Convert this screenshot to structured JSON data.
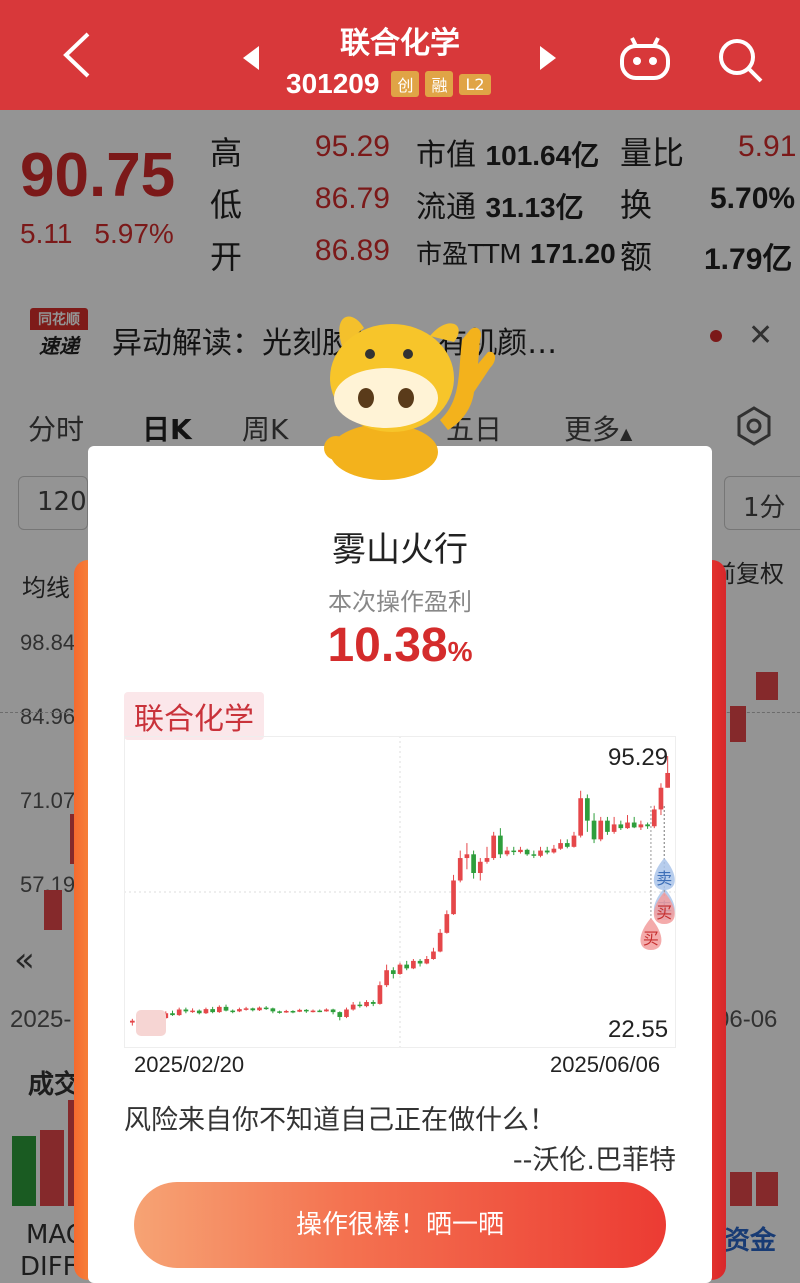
{
  "header": {
    "stock_name": "联合化学",
    "stock_code": "301209",
    "badges": [
      {
        "label": "创",
        "color": "#e2a13a"
      },
      {
        "label": "融",
        "color": "#e2a13a"
      },
      {
        "label": "L2",
        "color": "#e2a13a"
      }
    ]
  },
  "quote": {
    "price": "90.75",
    "change": "5.11",
    "change_pct": "5.97%",
    "high_label": "高",
    "high": "95.29",
    "low_label": "低",
    "low": "86.79",
    "open_label": "开",
    "open": "86.89",
    "mcap_label": "市值",
    "mcap": "101.64亿",
    "float_label": "流通",
    "float": "31.13亿",
    "pe_label": "市盈TTM",
    "pe": "171.20",
    "vr_label": "量比",
    "vr": "5.91",
    "turnover_label": "换",
    "turnover": "5.70%",
    "amount_label": "额",
    "amount": "1.79亿"
  },
  "news": {
    "logo_top": "同花顺",
    "logo_bottom": "速递",
    "text": "异动解读：光刻胶材料+有机颜…"
  },
  "tabs": [
    "分时",
    "日K",
    "周K",
    "五日",
    "更多"
  ],
  "background": {
    "period": "120",
    "interval": "1分",
    "ma_label": "均线",
    "adjust_label": "前复权",
    "axis": [
      "98.84",
      "84.96",
      "71.07",
      "57.19"
    ],
    "date_left": "2025-",
    "date_right": "06-06",
    "vol_label": "成交",
    "macd_1": "MAC",
    "macd_2": "DIFF",
    "fund_label": "资金"
  },
  "dialog": {
    "title": "雾山火行",
    "subtitle": "本次操作盈利",
    "profit_value": "10.38",
    "profit_unit": "%",
    "stock_tag": "联合化学",
    "chart_high": "95.29",
    "chart_low": "22.55",
    "date_start": "2025/02/20",
    "date_end": "2025/06/06",
    "quote": "风险来自你不知道自己正在做什么！",
    "author": "--沃伦.巴菲特",
    "button": "操作很棒！晒一晒",
    "markers": [
      "买",
      "卖",
      "买",
      "卖"
    ]
  },
  "colors": {
    "up": "#e5474a",
    "down": "#2e9e3c",
    "accent": "#d42c2c",
    "header": "#d8383a"
  },
  "chart_data": {
    "type": "candlestick",
    "x_start": "2025/02/20",
    "x_end": "2025/06/06",
    "ylim": [
      22.55,
      95.29
    ],
    "candles": [
      [
        24,
        24.5,
        23.2,
        25
      ],
      [
        24.5,
        24,
        23.8,
        25
      ],
      [
        24,
        25,
        23.9,
        25.4
      ],
      [
        25,
        24.6,
        24.2,
        25.3
      ],
      [
        24.6,
        25.2,
        24.5,
        25.6
      ],
      [
        25.2,
        26.5,
        25,
        27
      ],
      [
        26.5,
        26,
        25.8,
        27.2
      ],
      [
        26,
        27.5,
        25.8,
        28
      ],
      [
        27.5,
        27,
        26.5,
        28
      ],
      [
        27,
        27.2,
        26.6,
        27.8
      ],
      [
        27.2,
        26.5,
        26.2,
        27.5
      ],
      [
        26.5,
        27.6,
        26.3,
        28
      ],
      [
        27.6,
        26.8,
        26.5,
        28.2
      ],
      [
        26.8,
        28.2,
        26.6,
        28.6
      ],
      [
        28.2,
        27.2,
        27,
        28.8
      ],
      [
        27.2,
        27,
        26.5,
        27.5
      ],
      [
        27,
        27.6,
        26.8,
        28
      ],
      [
        27.6,
        27.8,
        27.2,
        28.2
      ],
      [
        27.8,
        27.3,
        27,
        28
      ],
      [
        27.3,
        28,
        27.1,
        28.3
      ],
      [
        28,
        27.8,
        27.4,
        28.4
      ],
      [
        27.8,
        27,
        26.5,
        28
      ],
      [
        27,
        26.8,
        26.4,
        27.2
      ],
      [
        26.8,
        27.1,
        26.6,
        27.4
      ],
      [
        27.1,
        26.9,
        26.5,
        27.3
      ],
      [
        26.9,
        27.4,
        26.8,
        27.7
      ],
      [
        27.4,
        27,
        26.6,
        27.6
      ],
      [
        27,
        27.2,
        26.7,
        27.5
      ],
      [
        27.2,
        27,
        26.8,
        27.5
      ],
      [
        27,
        27.5,
        26.9,
        27.8
      ],
      [
        27.5,
        26.8,
        26.2,
        27.7
      ],
      [
        26.8,
        25.5,
        24.6,
        27
      ],
      [
        25.5,
        27.5,
        25.2,
        28
      ],
      [
        27.5,
        28.8,
        27.2,
        29.5
      ],
      [
        28.8,
        28.4,
        28,
        29.6
      ],
      [
        28.4,
        29.5,
        28.1,
        30
      ],
      [
        29.5,
        29,
        28.4,
        30
      ],
      [
        29,
        34,
        28.8,
        35
      ],
      [
        34,
        38,
        33.5,
        39.5
      ],
      [
        38,
        37,
        35.8,
        38.8
      ],
      [
        37,
        39.5,
        36.8,
        40
      ],
      [
        39.5,
        38.5,
        38,
        40.5
      ],
      [
        38.5,
        40.5,
        38.3,
        41
      ],
      [
        40.5,
        39.8,
        39,
        41
      ],
      [
        39.8,
        41,
        39.6,
        41.8
      ],
      [
        41,
        43,
        40.8,
        44
      ],
      [
        43,
        48,
        42.8,
        49
      ],
      [
        48,
        53,
        47.8,
        54
      ],
      [
        53,
        62,
        52.8,
        63.5
      ],
      [
        62,
        68,
        61.5,
        70
      ],
      [
        68,
        69,
        65,
        72
      ],
      [
        69,
        64,
        62.5,
        70
      ],
      [
        64,
        67,
        62,
        68
      ],
      [
        67,
        68,
        66.5,
        71
      ],
      [
        68,
        74,
        67.5,
        75
      ],
      [
        74,
        69,
        68,
        76
      ],
      [
        69,
        70,
        68.5,
        71
      ],
      [
        70,
        69.6,
        68.8,
        71
      ],
      [
        69.6,
        70.2,
        69.2,
        71
      ],
      [
        70.2,
        69,
        68.6,
        70.5
      ],
      [
        69,
        68.6,
        68,
        70
      ],
      [
        68.6,
        70,
        68.2,
        71
      ],
      [
        70,
        69.5,
        69,
        71
      ],
      [
        69.5,
        70.5,
        69.2,
        71.5
      ],
      [
        70.5,
        72,
        70.2,
        73
      ],
      [
        72,
        71,
        70.6,
        73
      ],
      [
        71,
        74,
        70.8,
        75
      ],
      [
        74,
        84,
        73.5,
        86
      ],
      [
        84,
        78,
        75,
        85
      ],
      [
        78,
        73,
        72,
        80
      ],
      [
        73,
        78,
        72.5,
        79
      ],
      [
        78,
        75,
        74.2,
        79
      ],
      [
        75,
        77,
        74.5,
        79
      ],
      [
        77,
        76,
        75.5,
        78
      ],
      [
        76,
        77.5,
        75.8,
        79.5
      ],
      [
        77.5,
        76.2,
        76,
        79
      ],
      [
        76.2,
        77,
        75.5,
        78
      ],
      [
        77,
        76.5,
        75.8,
        77.5
      ],
      [
        76.5,
        81,
        76,
        82
      ],
      [
        81,
        86.8,
        79.5,
        88
      ],
      [
        86.8,
        90.75,
        86.8,
        95.29
      ]
    ]
  }
}
